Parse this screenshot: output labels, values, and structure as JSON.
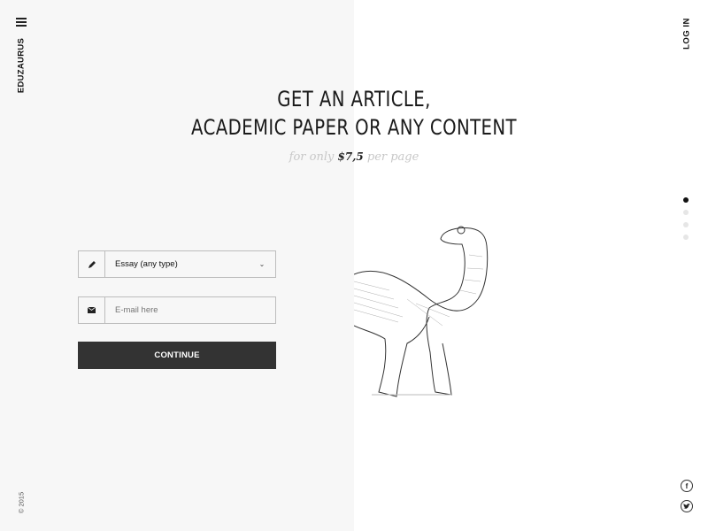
{
  "brand": {
    "name": "EDUZAURUS"
  },
  "header": {
    "login_label": "LOG IN"
  },
  "hero": {
    "headline_line1": "GET AN ARTICLE,",
    "headline_line2": "ACADEMIC PAPER OR ANY CONTENT",
    "sub_prefix": "for only",
    "sub_price": "$7,5",
    "sub_suffix": "per page"
  },
  "form": {
    "type_select": {
      "value": "Essay (any type)",
      "icon": "pen-icon"
    },
    "email_input": {
      "placeholder": "E-mail here",
      "value": "",
      "icon": "envelope-icon"
    },
    "continue_label": "CONTINUE"
  },
  "pagination": {
    "total": 4,
    "active_index": 0
  },
  "social": {
    "facebook_glyph": "f",
    "twitter_glyph": "t"
  },
  "footer": {
    "copyright": "© 2015"
  },
  "colors": {
    "left_panel": "#f7f7f7",
    "button": "#333333",
    "accent_text": "#222222",
    "muted_text": "#c8c8c8"
  }
}
